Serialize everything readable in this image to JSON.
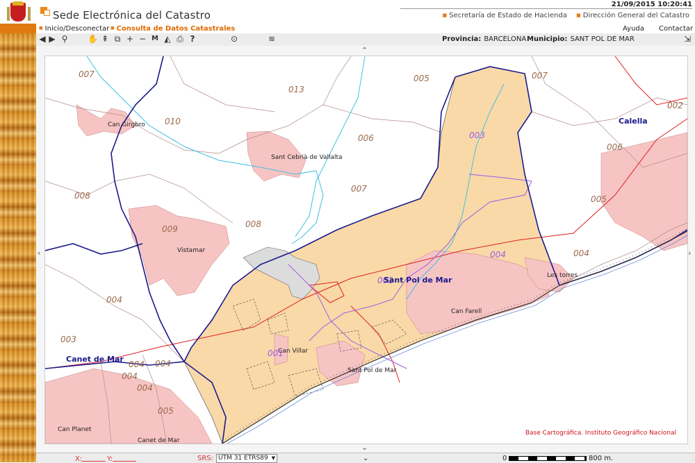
{
  "header": {
    "site_title": "Sede Electrónica del Catastro",
    "datetime": "21/09/2015  10:20:41",
    "gov_links": [
      "Secretaría de Estado de Hacienda",
      "Dirección General del Catastro"
    ]
  },
  "menu": {
    "login": "Inicio/Desconectar",
    "consulta": "Consulta de Datos Catastrales",
    "ayuda": "Ayuda",
    "contactar": "Contactar"
  },
  "toolbar": {
    "tools": [
      {
        "icon": "arrow-left-icon",
        "glyph": "◀"
      },
      {
        "icon": "arrow-right-icon",
        "glyph": "▶"
      },
      {
        "icon": "magnifier-icon",
        "glyph": "⚲"
      },
      {
        "icon": "pan-hand-icon",
        "glyph": "✋"
      },
      {
        "icon": "zoom-in-area-icon",
        "glyph": "⇞"
      },
      {
        "icon": "zoom-window-icon",
        "glyph": "⧉"
      },
      {
        "icon": "zoom-plus-icon",
        "glyph": "+"
      },
      {
        "icon": "zoom-minus-icon",
        "glyph": "−"
      },
      {
        "icon": "measure-icon",
        "glyph": "M"
      },
      {
        "icon": "area-icon",
        "glyph": "◭"
      },
      {
        "icon": "print-icon",
        "glyph": "⎙"
      },
      {
        "icon": "help-icon",
        "glyph": "?"
      },
      {
        "icon": "location-pin-icon",
        "glyph": "⊙"
      },
      {
        "icon": "layers-icon",
        "glyph": "≋"
      },
      {
        "icon": "exit-icon",
        "glyph": "⇲"
      }
    ],
    "provincia_label": "Provincia:",
    "provincia_value": "BARCELONA",
    "municipio_label": "Municipio:",
    "municipio_value": "SANT POL DE MAR"
  },
  "map": {
    "attribution": "Base Cartográfica. Instituto Geográfico Nacional",
    "polygon_labels": [
      "007",
      "013",
      "005",
      "007",
      "010",
      "006",
      "003",
      "002",
      "006",
      "007",
      "005",
      "008",
      "009",
      "008",
      "004",
      "004",
      "004",
      "004",
      "003",
      "004",
      "004",
      "004",
      "001",
      "005",
      "002"
    ],
    "place_labels": [
      "Can Girgbro",
      "Sant Cebrià de Vallalta",
      "Vistamar",
      "Sant Pol de Mar",
      "Can Farell",
      "Can Villar",
      "Sant Pol de Mar",
      "Les torres",
      "Can Planet",
      "Canet de Mar"
    ],
    "municipality_labels": [
      "Calella",
      "Sant Pol de Mar",
      "Canet de Mar"
    ],
    "colors": {
      "urban_fill": "#f7c4c4",
      "rustic_fill": "#f9d9a8",
      "municipal_boundary": "#1a1a8c",
      "road": "#e02020",
      "river": "#3fc0e0",
      "polygon_outline": "#a07070"
    }
  },
  "status": {
    "x_label": "X:",
    "y_label": "Y:",
    "srs_label": "SRS:",
    "srs_value": "UTM 31 ETRS89",
    "scale_start": "0",
    "scale_end": "800 m."
  }
}
